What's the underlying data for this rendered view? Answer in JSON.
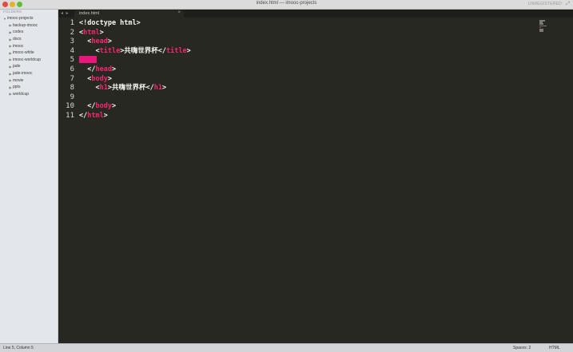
{
  "window": {
    "title": "index.html — imooc-projects",
    "registration": "UNREGISTERED"
  },
  "sidebar": {
    "header": "FOLDERS",
    "root": "imooc-projects",
    "folders": [
      "backup-imooc",
      "codes",
      "docs",
      "imooc",
      "imooc-white",
      "imooc-worldcup",
      "jade",
      "jade-imooc",
      "movie",
      "ppts",
      "worldcup"
    ]
  },
  "tabs": {
    "nav": "◂ ▸",
    "active": "index.html",
    "close": "×"
  },
  "editor": {
    "line_numbers": [
      "1",
      "2",
      "3",
      "4",
      "5",
      "6",
      "7",
      "8",
      "9",
      "10",
      "11"
    ],
    "lines": [
      "<!doctype html>",
      "<html>",
      "  <head>",
      "    <title>共嗨世界杯</title>",
      "",
      "  </head>",
      "  <body>",
      "    <h1>共嗨世界杯</h1>",
      "",
      "  </body>",
      "</html>"
    ]
  },
  "status": {
    "position": "Line 5, Column 5",
    "spaces": "Spaces: 2",
    "syntax": "HTML"
  },
  "colors": {
    "editor_bg": "#272822",
    "tag": "#f92672",
    "selection": "#e8177b",
    "sidebar_bg": "#e3e6ea"
  }
}
